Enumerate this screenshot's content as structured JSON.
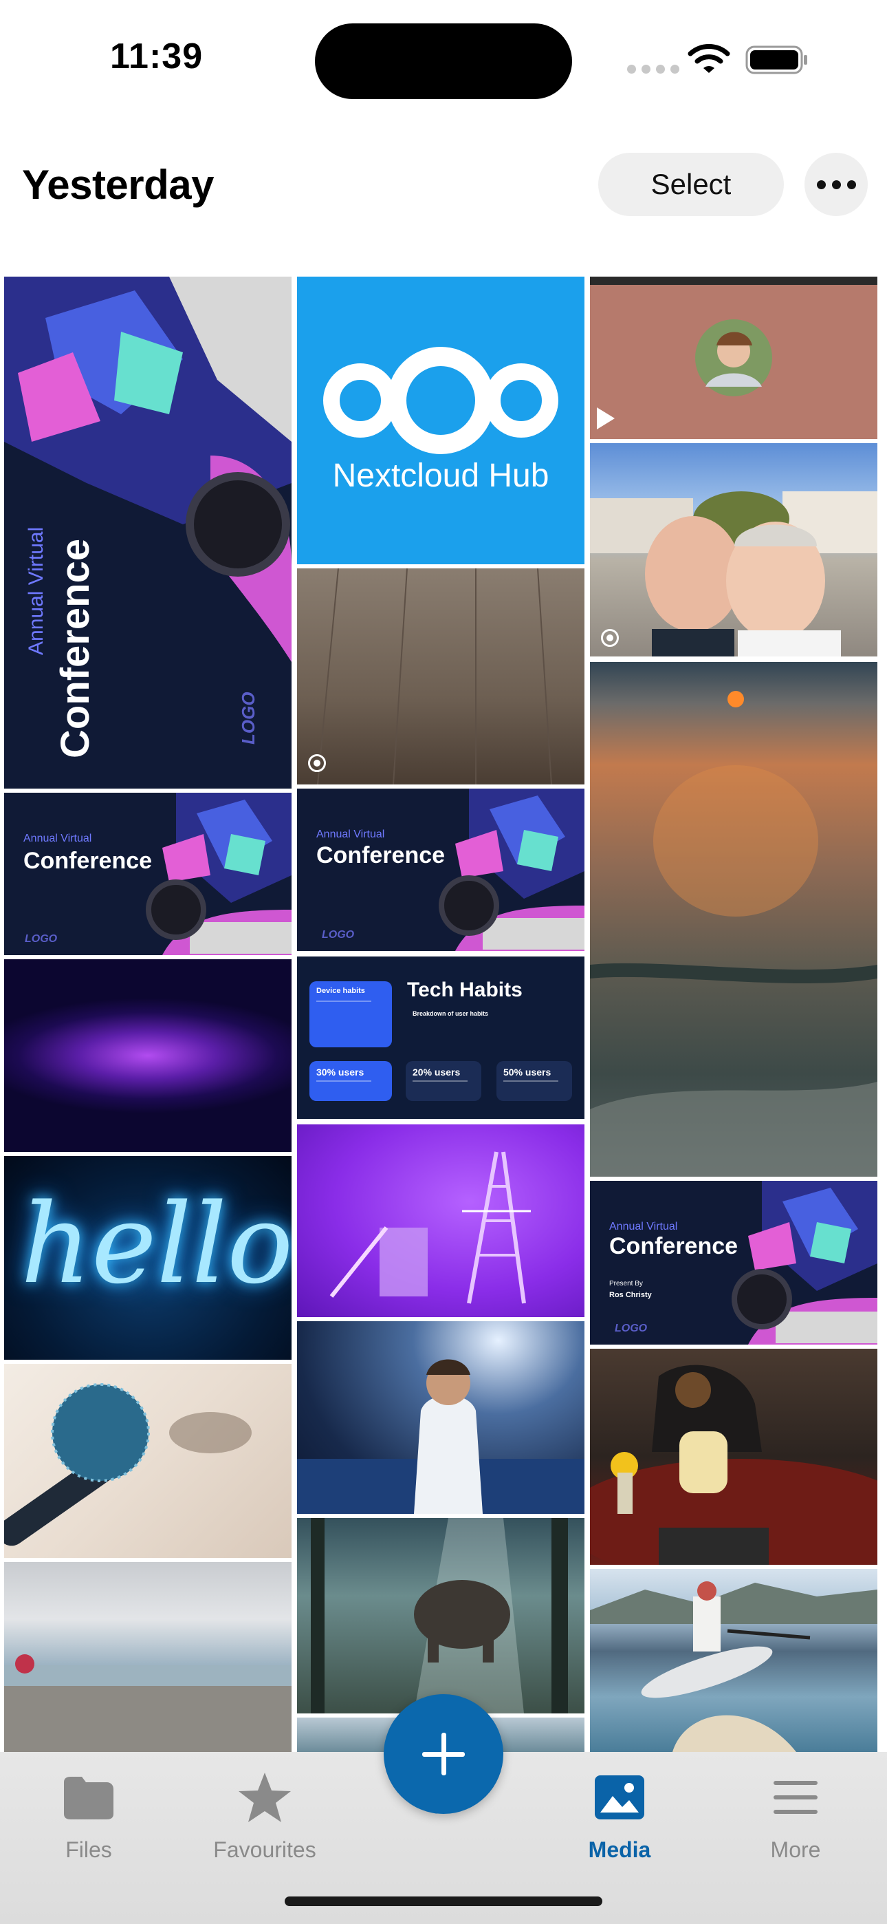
{
  "status_bar": {
    "time": "11:39"
  },
  "header": {
    "title": "Yesterday",
    "select_label": "Select"
  },
  "tiles": {
    "conf1": {
      "small": "Annual Virtual",
      "big": "Conference",
      "logo": "LOGO"
    },
    "nextcloud": {
      "text": "Nextcloud Hub"
    },
    "conf2": {
      "small": "Annual Virtual",
      "big": "Conference",
      "logo": "LOGO"
    },
    "conf3": {
      "small": "Annual Virtual",
      "big": "Conference",
      "logo": "LOGO"
    },
    "conf4": {
      "small": "Annual Virtual",
      "big": "Conference",
      "presenter_title": "Present By",
      "presenter": "Ros Christy",
      "logo": "LOGO"
    },
    "hello": {
      "text": "hello"
    },
    "tech": {
      "title": "Tech Habits",
      "subtitle": "Breakdown of user habits",
      "card1": "Device habits",
      "card2": "30% users",
      "card3": "20% users",
      "card4": "50% users"
    }
  },
  "tabbar": {
    "files": "Files",
    "favourites": "Favourites",
    "media": "Media",
    "more": "More"
  },
  "colors": {
    "accent": "#0b68ad",
    "active_tab": "#0a63a8"
  }
}
